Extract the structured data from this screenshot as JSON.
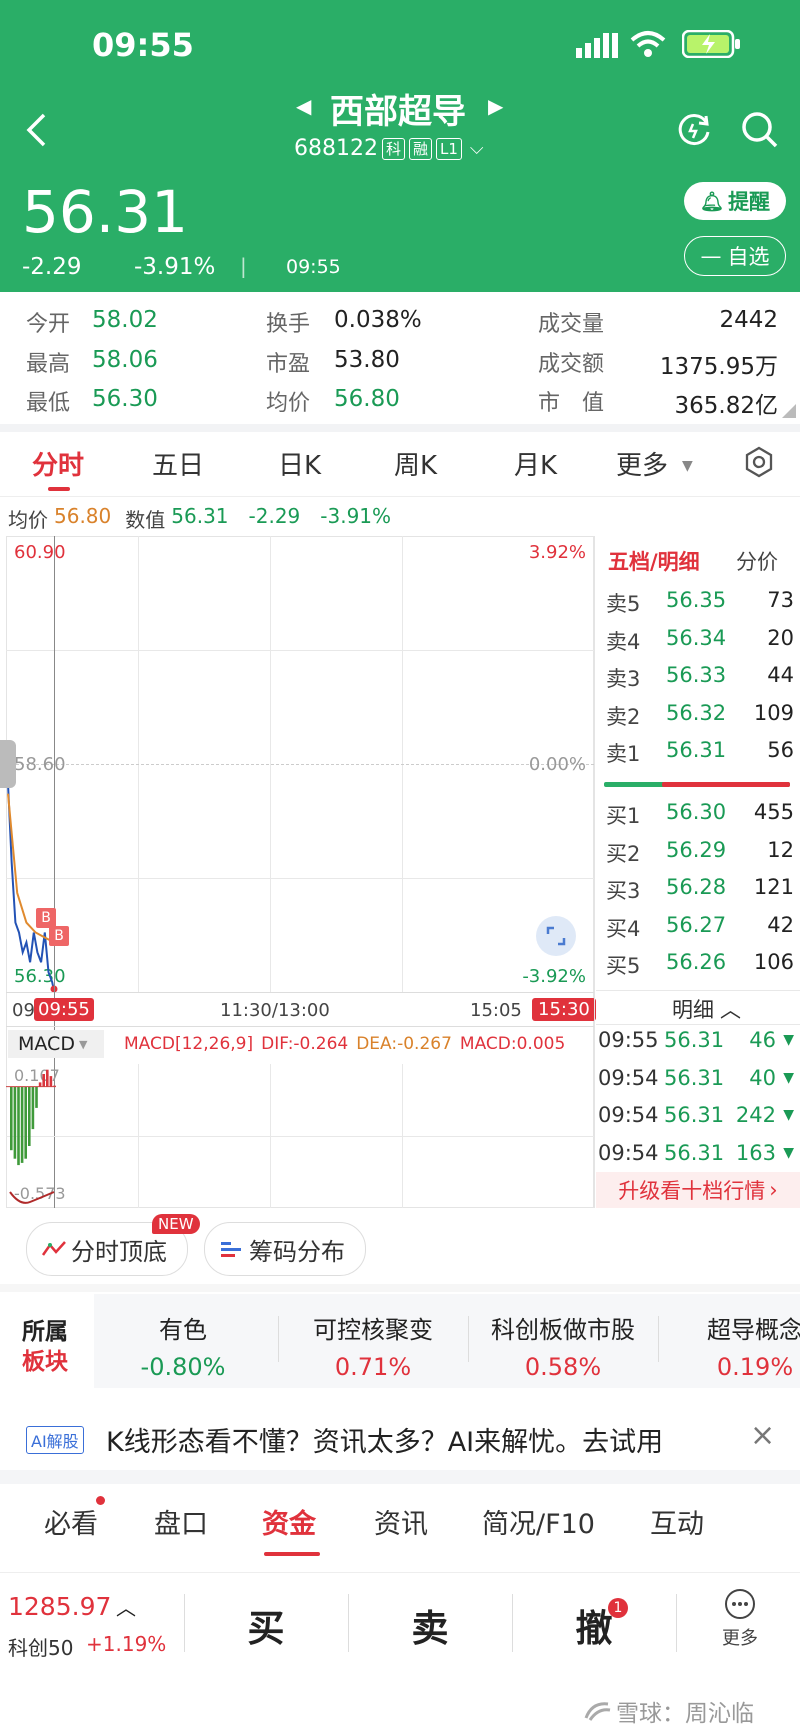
{
  "status_bar": {
    "time": "09:55"
  },
  "header": {
    "stock_name": "西部超导",
    "stock_code": "688122",
    "badges": [
      "科",
      "融",
      "L1"
    ],
    "price": "56.31",
    "change": "-2.29",
    "change_pct": "-3.91%",
    "time": "09:55",
    "alert_label": "提醒",
    "watch_label": "自选"
  },
  "stats": {
    "open_label": "今开",
    "open": "58.02",
    "high_label": "最高",
    "high": "58.06",
    "low_label": "最低",
    "low": "56.30",
    "turnover_label": "换手",
    "turnover": "0.038%",
    "pe_label": "市盈",
    "pe": "53.80",
    "avg_label": "均价",
    "avg": "56.80",
    "volume_label": "成交量",
    "volume": "2442",
    "amount_label": "成交额",
    "amount": "1375.95万",
    "mktcap_label": "市　值",
    "mktcap": "365.82亿"
  },
  "chart_tabs": [
    "分时",
    "五日",
    "日K",
    "周K",
    "月K",
    "更多"
  ],
  "info_line": {
    "avg_label": "均价",
    "avg": "56.80",
    "value_label": "数值",
    "value": "56.31",
    "change": "-2.29",
    "change_pct": "-3.91%"
  },
  "price_chart": {
    "y_top": "60.90",
    "y_mid": "58.60",
    "y_bottom": "56.30",
    "pct_top": "3.92%",
    "pct_mid": "0.00%",
    "pct_bottom": "-3.92%",
    "x_start": "09:30",
    "x_cursor": "09:55",
    "x_mid": "11:30/13:00",
    "x_late": "15:05",
    "x_end": "15:30",
    "marker": "B"
  },
  "chart_data": [
    {
      "type": "line",
      "title": "",
      "series": [
        {
          "name": "",
          "x": [
            "09:30",
            "09:32",
            "09:34",
            "09:36",
            "09:38",
            "09:40",
            "09:42",
            "09:44",
            "09:46",
            "09:48",
            "09:50",
            "09:52",
            "09:54",
            "09:55"
          ],
          "values": [
            58.4,
            57.6,
            57.0,
            56.9,
            56.7,
            56.8,
            56.6,
            56.9,
            56.7,
            56.6,
            56.9,
            56.5,
            56.4,
            56.31
          ]
        },
        {
          "name": "",
          "x": [
            "09:30",
            "09:35",
            "09:40",
            "09:45",
            "09:50",
            "09:55"
          ],
          "values": [
            58.3,
            57.3,
            57.0,
            56.9,
            56.85,
            56.8
          ]
        }
      ],
      "ylim": [
        56.3,
        60.9
      ],
      "xlabel": "",
      "ylabel": ""
    },
    {
      "type": "bar",
      "title": "MACD",
      "series": [
        {
          "name": "MACD",
          "values": [
            -0.3,
            -0.34,
            -0.37,
            -0.36,
            -0.34,
            -0.28,
            -0.2,
            -0.1,
            0.02,
            0.06,
            0.08,
            0.05,
            0.005
          ]
        }
      ],
      "ylim": [
        -0.573,
        0.107
      ]
    }
  ],
  "macd": {
    "label": "MACD",
    "params": "MACD[12,26,9]",
    "dif": "DIF:-0.264",
    "dea": "DEA:-0.267",
    "macd": "MACD:0.005",
    "y_top": "0.107",
    "y_bottom": "-0.573"
  },
  "order_book": {
    "tab_label": "五档/明细",
    "alt_label": "分价",
    "sells": [
      {
        "label": "卖5",
        "price": "56.35",
        "vol": "73"
      },
      {
        "label": "卖4",
        "price": "56.34",
        "vol": "20"
      },
      {
        "label": "卖3",
        "price": "56.33",
        "vol": "44"
      },
      {
        "label": "卖2",
        "price": "56.32",
        "vol": "109"
      },
      {
        "label": "卖1",
        "price": "56.31",
        "vol": "56"
      }
    ],
    "buys": [
      {
        "label": "买1",
        "price": "56.30",
        "vol": "455"
      },
      {
        "label": "买2",
        "price": "56.29",
        "vol": "12"
      },
      {
        "label": "买3",
        "price": "56.28",
        "vol": "121"
      },
      {
        "label": "买4",
        "price": "56.27",
        "vol": "42"
      },
      {
        "label": "买5",
        "price": "56.26",
        "vol": "106"
      }
    ],
    "detail_label": "明细",
    "ticks": [
      {
        "time": "09:55",
        "price": "56.31",
        "vol": "46"
      },
      {
        "time": "09:54",
        "price": "56.31",
        "vol": "40"
      },
      {
        "time": "09:54",
        "price": "56.31",
        "vol": "242"
      },
      {
        "time": "09:54",
        "price": "56.31",
        "vol": "163"
      }
    ],
    "upgrade_label": "升级看十档行情"
  },
  "tools": {
    "top_bottom_label": "分时顶底",
    "new_badge": "NEW",
    "chip_label": "筹码分布"
  },
  "sectors": {
    "title_line1": "所属",
    "title_line2": "板块",
    "items": [
      {
        "name": "有色",
        "pct": "-0.80%"
      },
      {
        "name": "可控核聚变",
        "pct": "0.71%"
      },
      {
        "name": "科创板做市股",
        "pct": "0.58%"
      },
      {
        "name": "超导概念",
        "pct": "0.19%"
      }
    ]
  },
  "ai_banner": {
    "tag": "AI解股",
    "text": "K线形态看不懂？资讯太多？AI来解忧。去试用"
  },
  "bottom_tabs": [
    "必看",
    "盘口",
    "资金",
    "资讯",
    "简况/F10",
    "互动"
  ],
  "index_bar": {
    "value": "1285.97",
    "name": "科创50",
    "change_pct": "+1.19%"
  },
  "trade_buttons": {
    "buy": "买",
    "sell": "卖",
    "cancel": "撤",
    "cancel_badge": "1",
    "more": "更多"
  },
  "watermark": "雪球：周沁临"
}
